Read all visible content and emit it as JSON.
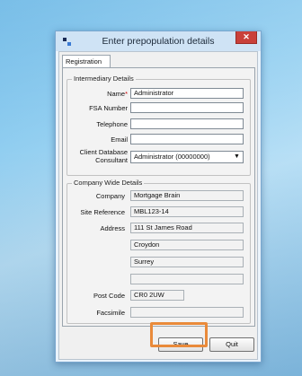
{
  "window": {
    "title": "Enter prepopulation details",
    "close_icon": "close-icon",
    "app_icon": "application-icon"
  },
  "tabs": [
    {
      "label": "Registration",
      "active": true
    }
  ],
  "intermediary": {
    "title": "Intermediary Details",
    "name_label": "Name",
    "name_required_mark": "*",
    "name_value": "Administrator",
    "fsa_label": "FSA Number",
    "fsa_value": "",
    "telephone_label": "Telephone",
    "telephone_value": "",
    "email_label": "Email",
    "email_value": "",
    "consultant_label_line1": "Client Database",
    "consultant_label_line2": "Consultant",
    "consultant_value": "Administrator (00000000)"
  },
  "company": {
    "title": "Company Wide Details",
    "company_label": "Company",
    "company_value": "Mortgage Brain",
    "site_label": "Site Reference",
    "site_value": "MBL123-14",
    "address_label": "Address",
    "address_lines": [
      "111 St James Road",
      "Croydon",
      "Surrey",
      ""
    ],
    "postcode_label": "Post Code",
    "postcode_value": "CR0 2UW",
    "fax_label": "Facsimile",
    "fax_value": ""
  },
  "buttons": {
    "save_label": "Save",
    "quit_label": "Quit"
  },
  "colors": {
    "highlight": "#e98a3a",
    "close_button": "#c9403a",
    "desktop": "#8fcdf0"
  }
}
